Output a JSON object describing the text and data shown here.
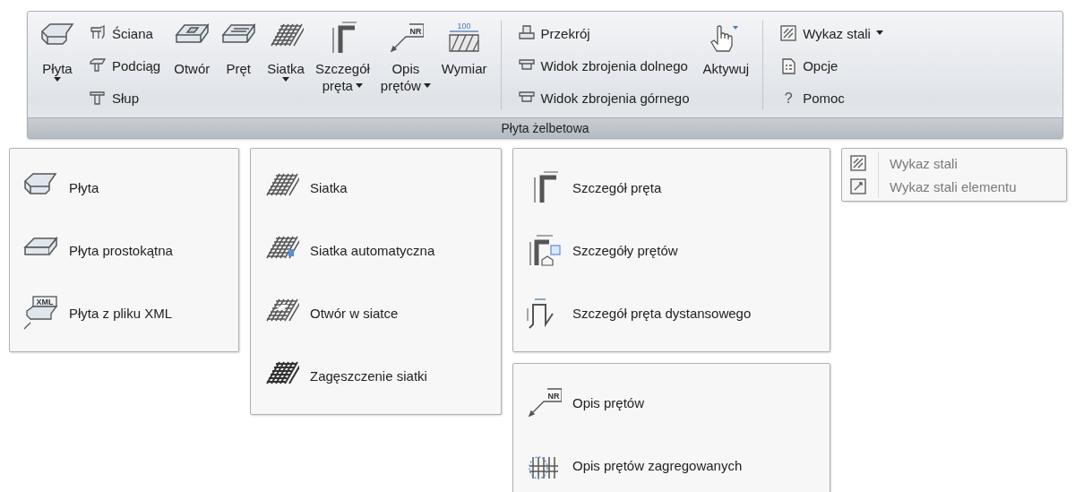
{
  "ribbon": {
    "controls": [
      {
        "kind": "large",
        "lines": [
          "Płyta"
        ],
        "dropdown": true
      },
      {
        "kind": "stack",
        "items": [
          {
            "label": "Ściana",
            "dropdown": false
          },
          {
            "label": "Podciąg",
            "dropdown": false
          },
          {
            "label": "Słup",
            "dropdown": false
          }
        ]
      },
      {
        "kind": "large",
        "lines": [
          "Otwór"
        ],
        "dropdown": false
      },
      {
        "kind": "large",
        "lines": [
          "Pręt"
        ],
        "dropdown": false
      },
      {
        "kind": "large",
        "lines": [
          "Siatka"
        ],
        "dropdown": true
      },
      {
        "kind": "large",
        "lines": [
          "Szczegół",
          "pręta"
        ],
        "dropdown": true
      },
      {
        "kind": "large",
        "icon_text": "NR",
        "lines": [
          "Opis",
          "prętów"
        ],
        "dropdown": true
      },
      {
        "kind": "large",
        "icon_text": "100",
        "lines": [
          "Wymiar"
        ],
        "dropdown": false
      },
      {
        "kind": "separator"
      },
      {
        "kind": "stack",
        "items": [
          {
            "label": "Przekrój",
            "dropdown": false
          },
          {
            "label": "Widok zbrojenia dolnego",
            "dropdown": false
          },
          {
            "label": "Widok zbrojenia górnego",
            "dropdown": false
          }
        ]
      },
      {
        "kind": "large",
        "lines": [
          "Aktywuj"
        ],
        "dropdown": false
      },
      {
        "kind": "separator"
      },
      {
        "kind": "stack",
        "items": [
          {
            "label": "Wykaz stali",
            "dropdown": true
          },
          {
            "label": "Opcje",
            "dropdown": false
          },
          {
            "icon_char": "?",
            "label": "Pomoc",
            "dropdown": false
          }
        ]
      }
    ],
    "group_title": "Płyta żelbetowa"
  },
  "menu_columns": [
    [
      {
        "kind": "menu",
        "items": [
          {
            "label": "Płyta",
            "disabled": false
          },
          {
            "label": "Płyta prostokątna",
            "disabled": false
          },
          {
            "icon_text": "XML",
            "label": "Płyta z pliku XML",
            "disabled": false
          }
        ]
      }
    ],
    [
      {
        "kind": "menu",
        "items": [
          {
            "label": "Siatka",
            "disabled": false
          },
          {
            "label": "Siatka automatyczna",
            "disabled": false
          },
          {
            "label": "Otwór w siatce",
            "disabled": false
          },
          {
            "label": "Zagęszczenie siatki",
            "disabled": false
          }
        ]
      }
    ],
    [
      {
        "kind": "menu",
        "items": [
          {
            "label": "Szczegół pręta",
            "disabled": false
          },
          {
            "label": "Szczegóły prętów",
            "disabled": false
          },
          {
            "label": "Szczegół pręta dystansowego",
            "disabled": false
          }
        ]
      },
      {
        "kind": "menu",
        "items": [
          {
            "icon_text": "NR",
            "label": "Opis prętów",
            "disabled": false
          },
          {
            "label": "Opis prętów zagregowanych",
            "disabled": false
          }
        ]
      }
    ],
    [
      {
        "kind": "compact-menu",
        "items": [
          {
            "label": "Wykaz stali",
            "disabled": true
          },
          {
            "label": "Wykaz stali elementu",
            "disabled": true
          }
        ]
      }
    ]
  ]
}
